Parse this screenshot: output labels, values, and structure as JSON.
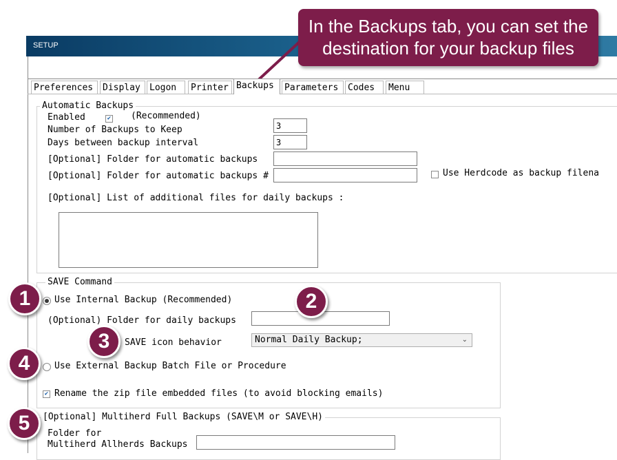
{
  "window": {
    "title": "SETUP"
  },
  "tabs": [
    "Preferences",
    "Display",
    "Logon",
    "Printer",
    "Backups",
    "Parameters",
    "Codes",
    "Menu"
  ],
  "automatic_backups": {
    "legend": "Automatic Backups",
    "enabled_label": "Enabled",
    "enabled_checked": true,
    "recommended_note": "(Recommended)",
    "num_backups_label": "Number of Backups to Keep",
    "num_backups_value": "3",
    "days_interval_label": "Days between backup interval",
    "days_interval_value": "3",
    "folder1_label": "[Optional] Folder for automatic backups",
    "folder1_value": "",
    "folder2_label": "[Optional] Folder for automatic backups #",
    "folder2_value": "",
    "herdcode_label": "Use Herdcode as backup filena",
    "herdcode_checked": false,
    "additional_files_label": "[Optional] List of additional files for daily backups :",
    "additional_files_value": ""
  },
  "save_command": {
    "legend": "SAVE Command",
    "internal_label": "Use Internal Backup (Recommended)",
    "internal_selected": true,
    "daily_folder_label": "(Optional) Folder for daily backups",
    "daily_folder_value": "",
    "icon_behavior_label": "SAVE icon behavior",
    "icon_behavior_value": "Normal Daily Backup;",
    "external_label": "Use External Backup Batch File or Procedure",
    "external_selected": false,
    "rename_zip_label": "Rename the zip file embedded files (to avoid blocking emails)",
    "rename_zip_checked": true
  },
  "multiherd": {
    "legend": "[Optional] Multiherd Full Backups (SAVE\\M or SAVE\\H)",
    "folder_label_line1": "Folder for",
    "folder_label_line2": "Multiherd Allherds Backups",
    "folder_value": ""
  },
  "annotations": {
    "callout_line1": "In the Backups tab, you can set the",
    "callout_line2": "destination for your backup files",
    "badge1": "1",
    "badge2": "2",
    "badge3": "3",
    "badge4": "4",
    "badge5": "5",
    "accent_color": "#7d1d4a"
  }
}
